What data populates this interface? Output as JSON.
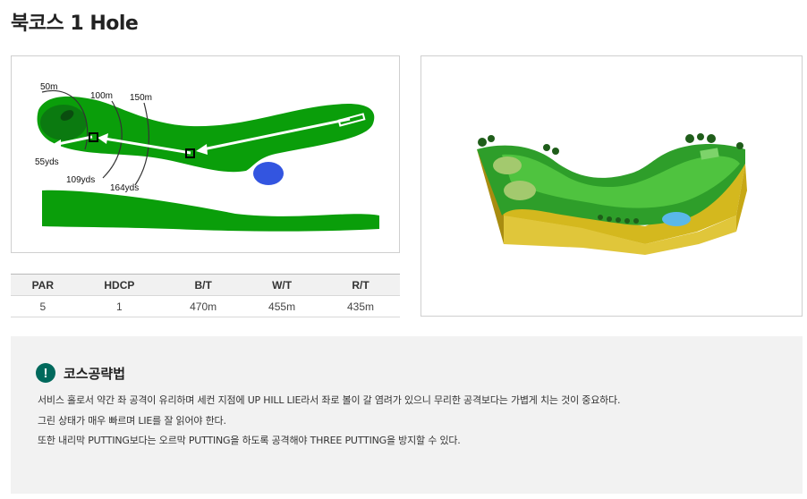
{
  "page": {
    "title": "북코스 1 Hole"
  },
  "hole_map": {
    "distance_labels": [
      "50m",
      "100m",
      "150m",
      "55yds",
      "109yds",
      "164yds"
    ]
  },
  "scorecard": {
    "headers": [
      "PAR",
      "HDCP",
      "B/T",
      "W/T",
      "R/T"
    ],
    "values": [
      "5",
      "1",
      "470m",
      "455m",
      "435m"
    ]
  },
  "strategy": {
    "icon": "!",
    "title": "코스공략법",
    "lines": [
      "서비스 홀로서 약간 좌 공격이 유리하며 세컨 지점에 UP HILL LIE라서 좌로 볼이 갈 염려가 있으니 무리한 공격보다는 가볍게 치는 것이 중요하다.",
      "그린 상태가 매우 빠르며 LIE를 잘 읽어야 한다.",
      "또한 내리막 PUTTING보다는 오르막 PUTTING을 하도록 공격해야 THREE PUTTING을 방지할 수 있다."
    ]
  },
  "colors": {
    "fairway": "#0a9e0a",
    "rough": "#0b7a10",
    "water": "#3355e0",
    "accent": "#00695c"
  }
}
